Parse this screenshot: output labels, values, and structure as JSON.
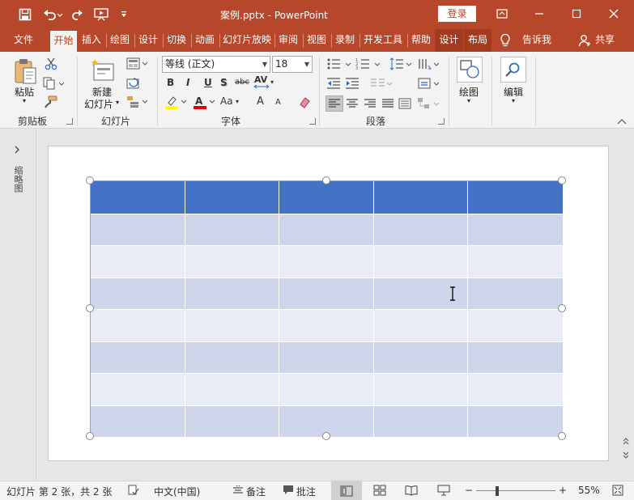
{
  "titlebar": {
    "doc_title": "案例.pptx  -  PowerPoint",
    "login_label": "登录",
    "qat_icons": [
      "save-icon",
      "undo-icon",
      "redo-icon",
      "start-from-beginning-icon",
      "customize-qat-icon"
    ],
    "window_icons": [
      "ribbon-display-options-icon",
      "minimize-icon",
      "maximize-icon",
      "close-icon"
    ],
    "accent": "#b7472a"
  },
  "tabs": {
    "items": [
      {
        "label": "文件"
      },
      {
        "label": "开始",
        "active": true
      },
      {
        "label": "插入"
      },
      {
        "label": "绘图"
      },
      {
        "label": "设计"
      },
      {
        "label": "切换"
      },
      {
        "label": "动画"
      },
      {
        "label": "幻灯片放映"
      },
      {
        "label": "审阅"
      },
      {
        "label": "视图"
      },
      {
        "label": "录制"
      },
      {
        "label": "开发工具"
      },
      {
        "label": "帮助"
      },
      {
        "label": "设计",
        "contextual": true
      },
      {
        "label": "布局",
        "contextual": true
      }
    ],
    "tell_me": "告诉我",
    "share": "共享"
  },
  "ribbon": {
    "clipboard": {
      "paste_label": "粘贴",
      "group_label": "剪贴板"
    },
    "slides": {
      "new_slide_label_1": "新建",
      "new_slide_label_2": "幻灯片",
      "group_label": "幻灯片"
    },
    "font": {
      "font_name": "等线 (正文)",
      "font_size": "18",
      "bold": "B",
      "italic": "I",
      "underline": "U",
      "shadow": "S",
      "strike": "abc",
      "spacing": "AV",
      "case": "Aa",
      "grow": "A",
      "shrink": "A",
      "group_label": "字体"
    },
    "paragraph": {
      "group_label": "段落"
    },
    "drawing": {
      "label": "绘图"
    },
    "editing": {
      "label": "编辑"
    }
  },
  "left_panel": {
    "expand_icon": "chevron-right-icon",
    "thumbnail_label": "缩略图"
  },
  "slide": {
    "table": {
      "columns": 5,
      "header_color": "#4472c4",
      "band_dark": "#cfd5ea",
      "band_light": "#e9ebf5",
      "rows": [
        {
          "type": "header",
          "cells": [
            "",
            "",
            "",
            "",
            ""
          ]
        },
        {
          "type": "dark",
          "cells": [
            "",
            "",
            "",
            "",
            ""
          ]
        },
        {
          "type": "light",
          "cells": [
            "",
            "",
            "",
            "",
            ""
          ]
        },
        {
          "type": "dark",
          "cells": [
            "",
            "",
            "",
            "",
            ""
          ]
        },
        {
          "type": "light",
          "cells": [
            "",
            "",
            "",
            "",
            ""
          ]
        },
        {
          "type": "dark",
          "cells": [
            "",
            "",
            "",
            "",
            ""
          ]
        },
        {
          "type": "light",
          "cells": [
            "",
            "",
            "",
            "",
            ""
          ]
        },
        {
          "type": "dark",
          "cells": [
            "",
            "",
            "",
            "",
            ""
          ]
        }
      ]
    }
  },
  "statusbar": {
    "slide_info": "幻灯片 第 2 张，共 2 张",
    "language": "中文(中国)",
    "notes": "备注",
    "comments": "批注",
    "zoom_minus": "−",
    "zoom_plus": "+",
    "zoom_value": "55%",
    "zoom_percent": 55
  }
}
